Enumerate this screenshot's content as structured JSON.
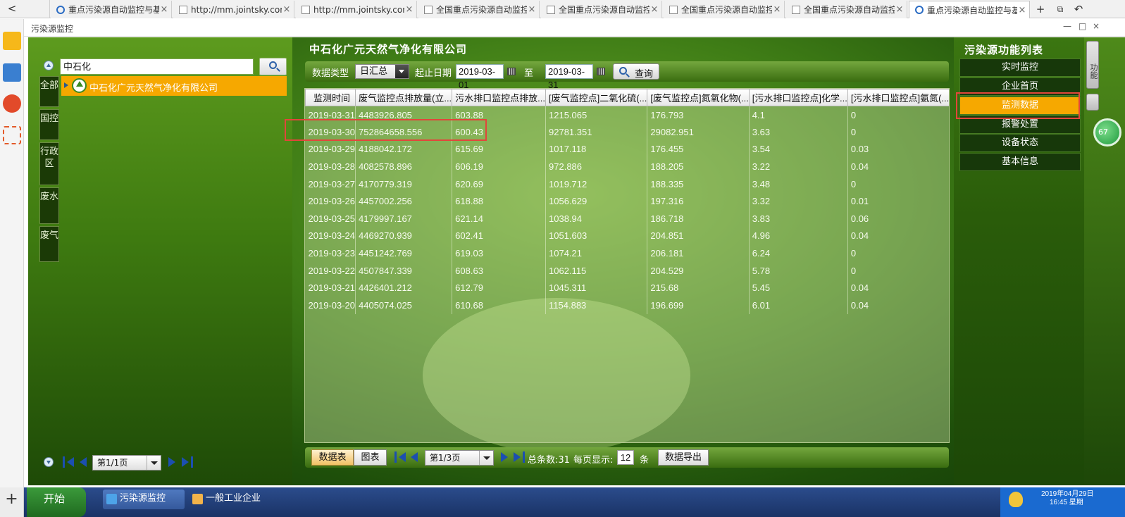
{
  "browser": {
    "back_label": "<",
    "tabs": [
      {
        "label": "重点污染源自动监控与基",
        "active": false
      },
      {
        "label": "http://mm.jointsky.com",
        "active": false
      },
      {
        "label": "http://mm.jointsky.com",
        "active": false
      },
      {
        "label": "全国重点污染源自动监控",
        "active": false
      },
      {
        "label": "全国重点污染源自动监控",
        "active": false
      },
      {
        "label": "全国重点污染源自动监控",
        "active": false
      },
      {
        "label": "全国重点污染源自动监控",
        "active": false
      },
      {
        "label": "重点污染源自动监控与基",
        "active": true
      }
    ],
    "close_glyph": "×",
    "new_tab_glyph": "+",
    "window_title": "污染源监控",
    "window_controls": [
      "—",
      "□",
      "×"
    ]
  },
  "left_panel": {
    "search_value": "中石化",
    "vertical_tabs": [
      {
        "label": "全部"
      },
      {
        "label": "国控"
      },
      {
        "label": "行政区"
      },
      {
        "label": "废水"
      },
      {
        "label": "废气"
      }
    ],
    "tree_item": "中石化广元天然气净化有限公司",
    "pager_text": "第1/1页"
  },
  "center": {
    "company_title": "中石化广元天然气净化有限公司",
    "toolbar": {
      "data_type_label": "数据类型",
      "data_type_value": "日汇总",
      "date_range_label": "起止日期",
      "start_date": "2019-03-01",
      "to_label": "至",
      "end_date": "2019-03-31",
      "query_label": "查询"
    },
    "table": {
      "columns": [
        "监测时间",
        "废气监控点排放量(立...",
        "污水排口监控点排放...",
        "[废气监控点]二氧化硫(...",
        "[废气监控点]氮氧化物(...",
        "[污水排口监控点]化学...",
        "[污水排口监控点]氨氮(..."
      ],
      "rows": [
        [
          "2019-03-31",
          "4483926.805",
          "603.88",
          "1215.065",
          "176.793",
          "4.1",
          "0"
        ],
        [
          "2019-03-30",
          "752864658.556",
          "600.43",
          "92781.351",
          "29082.951",
          "3.63",
          "0"
        ],
        [
          "2019-03-29",
          "4188042.172",
          "615.69",
          "1017.118",
          "176.455",
          "3.54",
          "0.03"
        ],
        [
          "2019-03-28",
          "4082578.896",
          "606.19",
          "972.886",
          "188.205",
          "3.22",
          "0.04"
        ],
        [
          "2019-03-27",
          "4170779.319",
          "620.69",
          "1019.712",
          "188.335",
          "3.48",
          "0"
        ],
        [
          "2019-03-26",
          "4457002.256",
          "618.88",
          "1056.629",
          "197.316",
          "3.32",
          "0.01"
        ],
        [
          "2019-03-25",
          "4179997.167",
          "621.14",
          "1038.94",
          "186.718",
          "3.83",
          "0.06"
        ],
        [
          "2019-03-24",
          "4469270.939",
          "602.41",
          "1051.603",
          "204.851",
          "4.96",
          "0.04"
        ],
        [
          "2019-03-23",
          "4451242.769",
          "619.03",
          "1074.21",
          "206.181",
          "6.24",
          "0"
        ],
        [
          "2019-03-22",
          "4507847.339",
          "608.63",
          "1062.115",
          "204.529",
          "5.78",
          "0"
        ],
        [
          "2019-03-21",
          "4426401.212",
          "612.79",
          "1045.311",
          "215.68",
          "5.45",
          "0.04"
        ],
        [
          "2019-03-20",
          "4405074.025",
          "610.68",
          "1154.883",
          "196.699",
          "6.01",
          "0.04"
        ]
      ]
    },
    "bottom": {
      "view_table_label": "数据表",
      "view_chart_label": "图表",
      "pager_text": "第1/3页",
      "total_label": "总条数:31",
      "per_page_label": "每页显示:",
      "per_page_value": "12",
      "unit_label": "条",
      "export_label": "数据导出"
    }
  },
  "right_panel": {
    "title": "污染源功能列表",
    "items": [
      {
        "label": "实时监控"
      },
      {
        "label": "企业首页"
      },
      {
        "label": "监测数据"
      },
      {
        "label": "报警处置"
      },
      {
        "label": "设备状态"
      },
      {
        "label": "基本信息"
      }
    ],
    "selected_index": 2,
    "side_button_label": "功能",
    "badge_value": "67"
  },
  "taskbar": {
    "plus_glyph": "+",
    "start_label": "开始",
    "tasks": [
      {
        "label": "污染源监控"
      },
      {
        "label": "一般工业企业"
      }
    ],
    "clock_date": "2019年04月29日",
    "clock_time": "16:45 星期"
  },
  "colors": {
    "accent_orange": "#f6a800",
    "highlight_red": "#e2463b",
    "panel_green": "#3f7d16"
  }
}
